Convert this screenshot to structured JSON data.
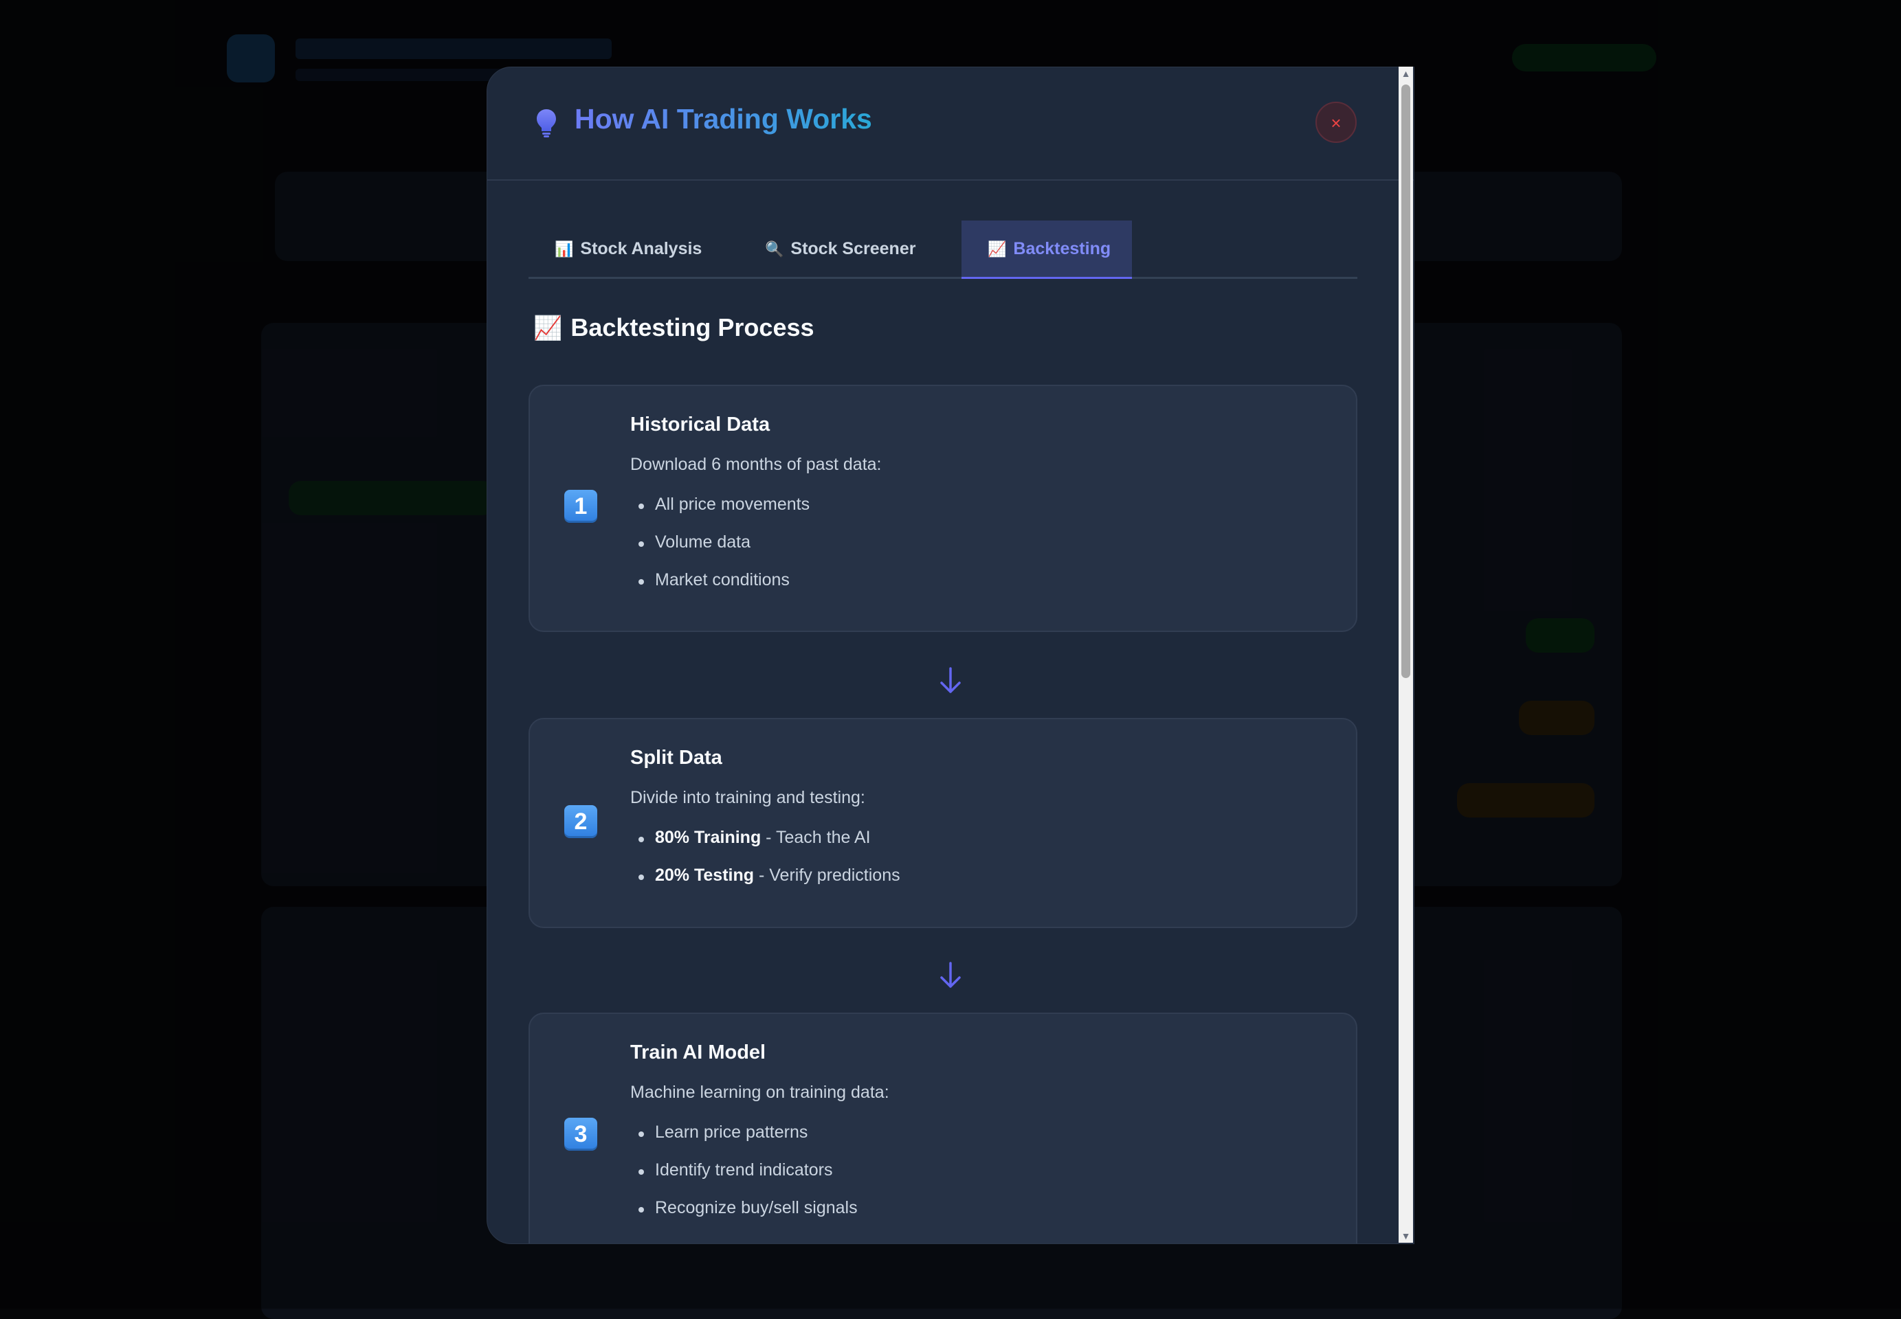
{
  "modal": {
    "title": "How AI Trading Works",
    "close_label": "×"
  },
  "tabs": [
    {
      "icon": "📊",
      "label": "Stock Analysis"
    },
    {
      "icon": "🔍",
      "label": "Stock Screener"
    },
    {
      "icon": "📈",
      "label": "Backtesting",
      "active": true
    }
  ],
  "section": {
    "icon": "📈",
    "title": "Backtesting Process"
  },
  "steps": [
    {
      "number": "1",
      "title": "Historical Data",
      "description": "Download 6 months of past data:",
      "items": [
        "All price movements",
        "Volume data",
        "Market conditions"
      ]
    },
    {
      "number": "2",
      "title": "Split Data",
      "description": "Divide into training and testing:",
      "items": [
        {
          "bold": "80% Training",
          "rest": " - Teach the AI"
        },
        {
          "bold": "20% Testing",
          "rest": " - Verify predictions"
        }
      ]
    },
    {
      "number": "3",
      "title": "Train AI Model",
      "description": "Machine learning on training data:",
      "items": [
        "Learn price patterns",
        "Identify trend indicators",
        "Recognize buy/sell signals"
      ]
    }
  ],
  "colors": {
    "accent": "#6366f1",
    "title_gradient_start": "#6d7cf5",
    "title_gradient_end": "#2aa8d8",
    "close": "#ef4444",
    "badge": "#3b8ee8"
  },
  "scrollbar": {
    "up": "▲",
    "down": "▼"
  }
}
